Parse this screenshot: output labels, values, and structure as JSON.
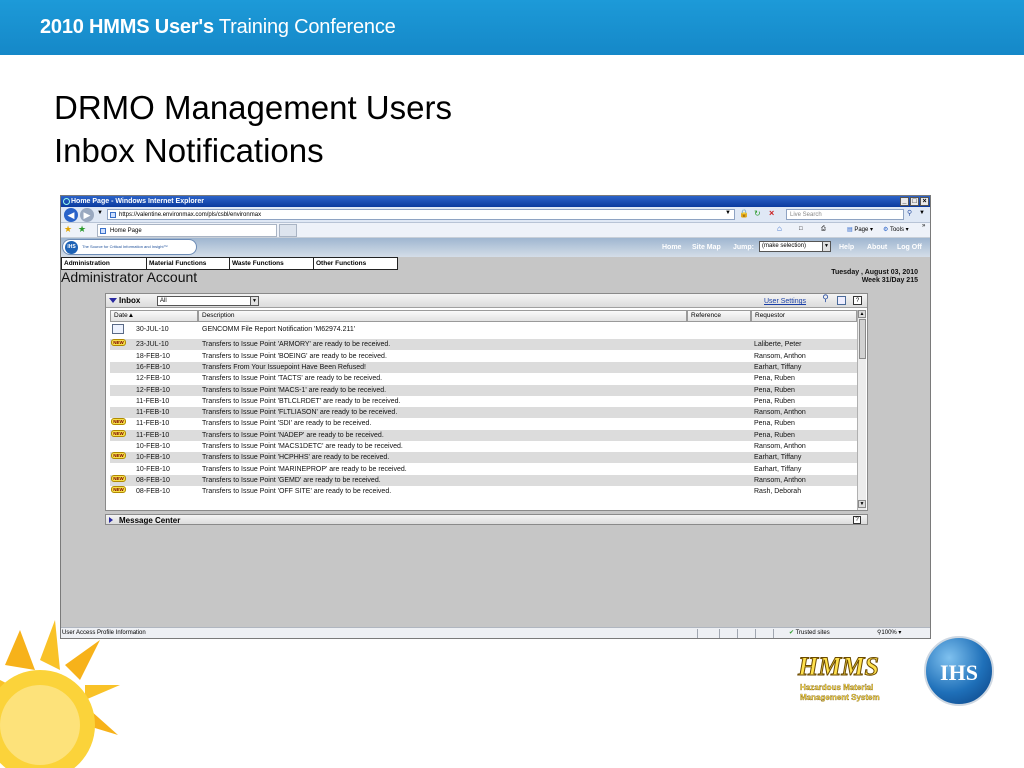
{
  "slide": {
    "band_title_bold": "2010 HMMS User's",
    "band_title_rest": "Training Conference",
    "title_line1": "DRMO Management Users",
    "title_line2": "Inbox Notifications"
  },
  "browser": {
    "window_title": "Home Page - Windows Internet Explorer",
    "url": "https://valentine.environmax.com/pls/csbl/environmax",
    "search_placeholder": "Live Search",
    "tab_label": "Home Page",
    "cmd_page": "Page",
    "cmd_tools": "Tools",
    "status_left": "User Access Profile Information",
    "status_trusted": "Trusted sites",
    "status_zoom": "100%"
  },
  "app": {
    "brand_tagline": "The Source for Critical Information and Insight™",
    "top_nav": [
      "Home",
      "Site Map",
      "Jump:",
      "Help",
      "About",
      "Log Off"
    ],
    "jump_value": "(make selection)",
    "menu": [
      "Administration",
      "Material Functions",
      "Waste Functions",
      "Other Functions"
    ],
    "account_title": "Administrator Account",
    "date_line1": "Tuesday , August 03, 2010",
    "date_line2": "Week 31/Day 215"
  },
  "inbox": {
    "label": "Inbox",
    "filter_value": "All",
    "user_settings": "User Settings",
    "columns": [
      "Date▲",
      "Description",
      "Reference",
      "Requestor"
    ],
    "new_badge": "NEW",
    "rows": [
      {
        "date": "30-JUL-10",
        "desc": "GENCOMM File Report Notification 'M62974.211'",
        "ref": "",
        "req": "",
        "badge": "mail"
      },
      {
        "date": "23-JUL-10",
        "desc": "Transfers to Issue Point 'ARMORY' are ready to be received.",
        "ref": "",
        "req": "Laliberte, Peter",
        "badge": "new"
      },
      {
        "date": "18-FEB-10",
        "desc": "Transfers to Issue Point 'BOEING' are ready to be received.",
        "ref": "",
        "req": "Ransom, Anthon",
        "badge": ""
      },
      {
        "date": "16-FEB-10",
        "desc": "Transfers From Your Issuepoint Have Been Refused!",
        "ref": "",
        "req": "Earhart, Tiffany",
        "badge": ""
      },
      {
        "date": "12-FEB-10",
        "desc": "Transfers to Issue Point 'TACTS' are ready to be received.",
        "ref": "",
        "req": "Pena, Ruben",
        "badge": ""
      },
      {
        "date": "12-FEB-10",
        "desc": "Transfers to Issue Point 'MACS-1' are ready to be received.",
        "ref": "",
        "req": "Pena, Ruben",
        "badge": ""
      },
      {
        "date": "11-FEB-10",
        "desc": "Transfers to Issue Point 'BTLCLRDET' are ready to be received.",
        "ref": "",
        "req": "Pena, Ruben",
        "badge": ""
      },
      {
        "date": "11-FEB-10",
        "desc": "Transfers to Issue Point 'FLTLIASON' are ready to be received.",
        "ref": "",
        "req": "Ransom, Anthon",
        "badge": ""
      },
      {
        "date": "11-FEB-10",
        "desc": "Transfers to Issue Point 'SDI' are ready to be received.",
        "ref": "",
        "req": "Pena, Ruben",
        "badge": "new"
      },
      {
        "date": "11-FEB-10",
        "desc": "Transfers to Issue Point 'NADEP' are ready to be received.",
        "ref": "",
        "req": "Pena, Ruben",
        "badge": "new"
      },
      {
        "date": "10-FEB-10",
        "desc": "Transfers to Issue Point 'MACS1DETC' are ready to be received.",
        "ref": "",
        "req": "Ransom, Anthon",
        "badge": ""
      },
      {
        "date": "10-FEB-10",
        "desc": "Transfers to Issue Point 'HCPHHS' are ready to be received.",
        "ref": "",
        "req": "Earhart, Tiffany",
        "badge": "new"
      },
      {
        "date": "10-FEB-10",
        "desc": "Transfers to Issue Point 'MARINEPROP' are ready to be received.",
        "ref": "",
        "req": "Earhart, Tiffany",
        "badge": ""
      },
      {
        "date": "08-FEB-10",
        "desc": "Transfers to Issue Point 'GEMD' are ready to be received.",
        "ref": "",
        "req": "Ransom, Anthon",
        "badge": "new"
      },
      {
        "date": "08-FEB-10",
        "desc": "Transfers to Issue Point 'OFF SITE' are ready to be received.",
        "ref": "",
        "req": "Rash, Deborah",
        "badge": "new"
      }
    ]
  },
  "message_center": {
    "label": "Message Center"
  },
  "logos": {
    "hmms_name": "HMMS",
    "hmms_sub1": "Hazardous Material",
    "hmms_sub2": "Management System",
    "ihs_name": "IHS"
  },
  "colors": {
    "band": "#1d9ad8",
    "app_background": "#c6c6c6",
    "alt_row": "#dcdcdc",
    "link": "#1a3fa6"
  }
}
